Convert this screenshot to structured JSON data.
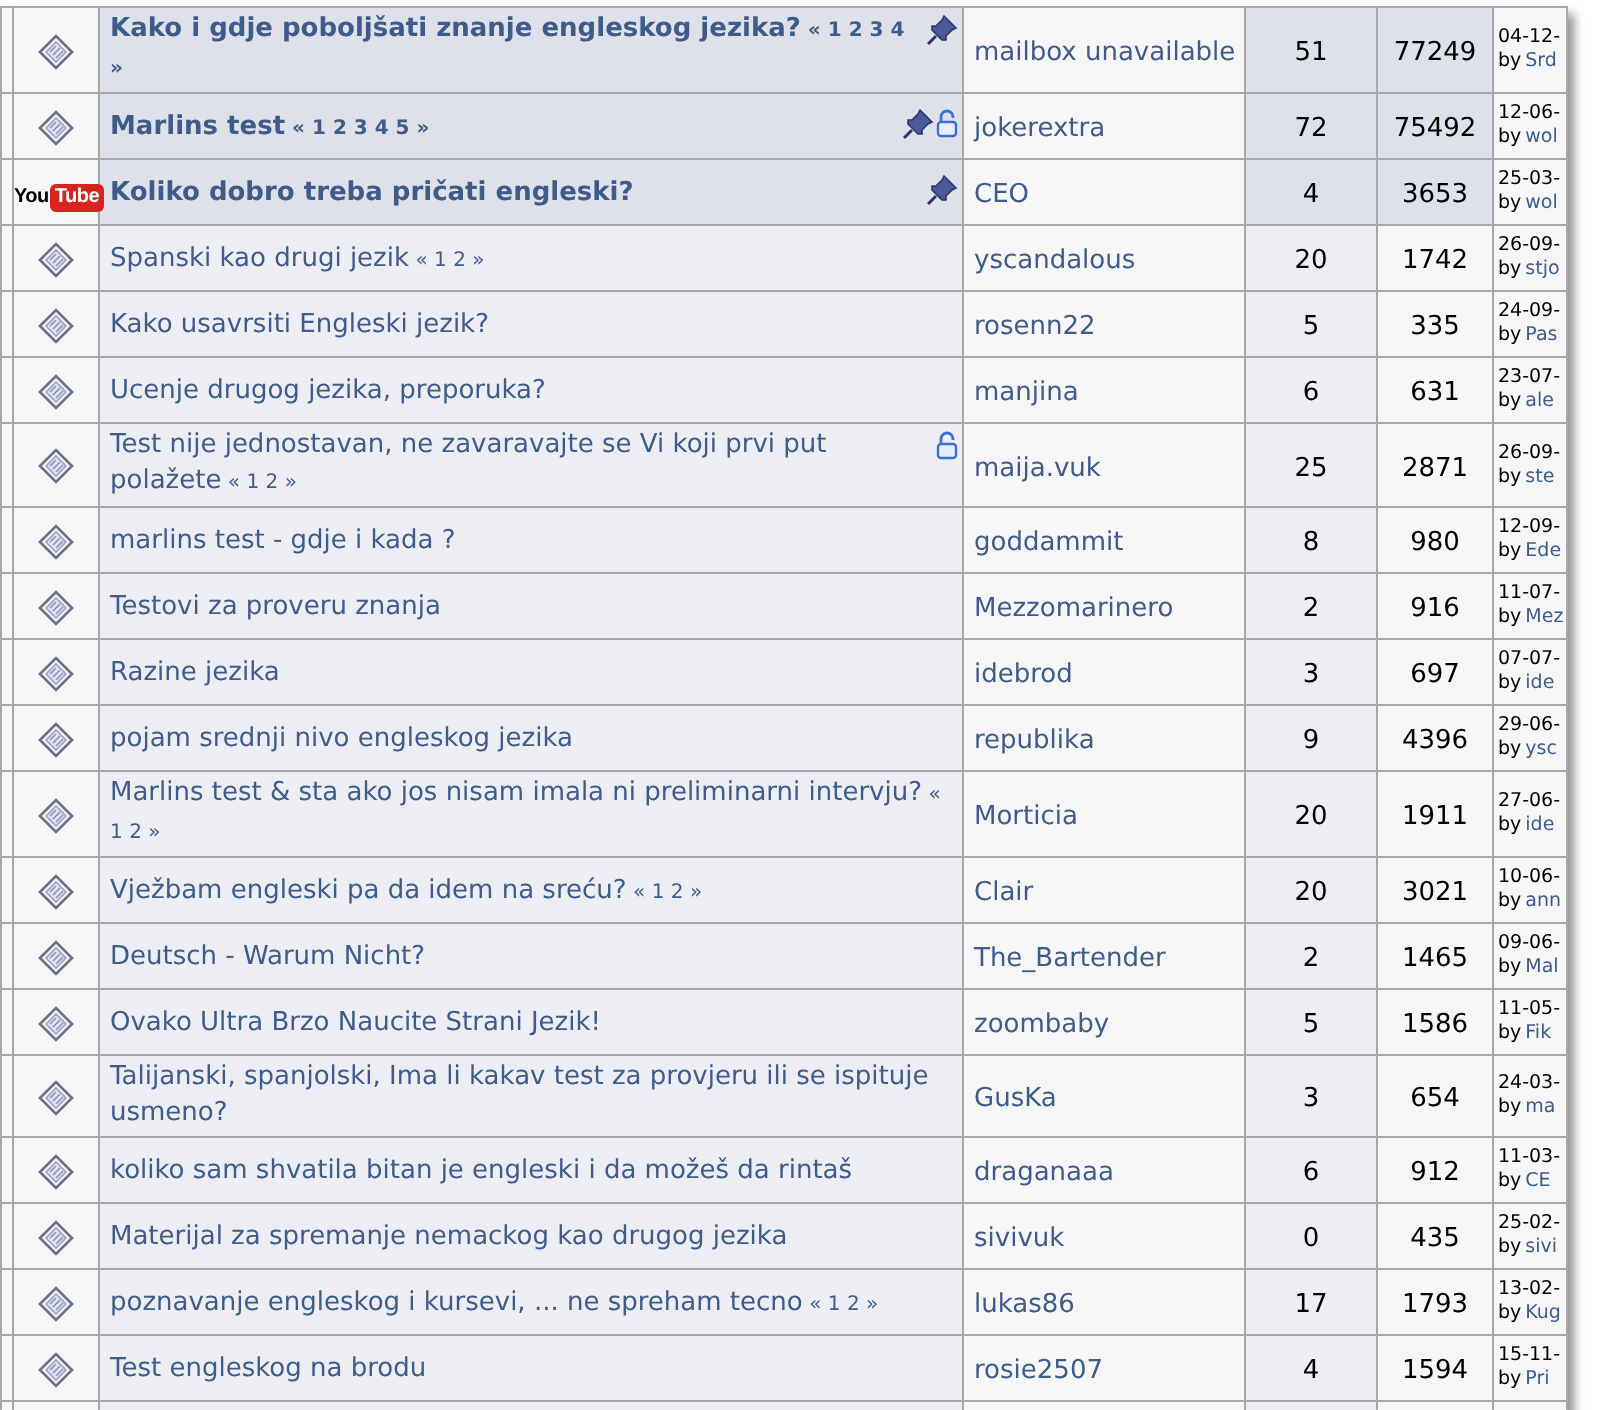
{
  "topics": [
    {
      "kind": "topic",
      "title": "Kako i gdje poboljšati znanje engleskog jezika?",
      "sticky": true,
      "pinned": true,
      "locked": false,
      "pages": {
        "open": "«",
        "numbers": [
          "1",
          "2",
          "3",
          "4"
        ],
        "close": "»"
      },
      "author": "mailbox unavailable",
      "replies": "51",
      "views": "77249",
      "last_date": "04-12-",
      "last_by": "by",
      "last_user": "Srd"
    },
    {
      "kind": "topic",
      "title": "Marlins test",
      "sticky": true,
      "pinned": true,
      "locked": true,
      "pages": {
        "open": "«",
        "numbers": [
          "1",
          "2",
          "3",
          "4",
          "5"
        ],
        "close": "»"
      },
      "author": "jokerextra",
      "replies": "72",
      "views": "75492",
      "last_date": "12-06-",
      "last_by": "by",
      "last_user": "wol"
    },
    {
      "kind": "youtube",
      "logo": {
        "left": "You",
        "right": "Tube"
      },
      "title": "Koliko dobro treba pričati engleski?",
      "sticky": true,
      "pinned": true,
      "locked": false,
      "author": "CEO",
      "replies": "4",
      "views": "3653",
      "last_date": "25-03-",
      "last_by": "by",
      "last_user": "wol"
    },
    {
      "kind": "topic",
      "title": "Spanski kao drugi jezik",
      "sticky": false,
      "pinned": false,
      "locked": false,
      "pages": {
        "open": "«",
        "numbers": [
          "1",
          "2"
        ],
        "close": "»"
      },
      "author": "yscandalous",
      "replies": "20",
      "views": "1742",
      "last_date": "26-09-",
      "last_by": "by",
      "last_user": "stjo"
    },
    {
      "kind": "topic",
      "title": "Kako usavrsiti Engleski jezik?",
      "sticky": false,
      "pinned": false,
      "locked": false,
      "author": "rosenn22",
      "replies": "5",
      "views": "335",
      "last_date": "24-09-",
      "last_by": "by",
      "last_user": "Pas"
    },
    {
      "kind": "topic",
      "title": "Ucenje drugog jezika, preporuka?",
      "sticky": false,
      "pinned": false,
      "locked": false,
      "author": "manjina",
      "replies": "6",
      "views": "631",
      "last_date": "23-07-",
      "last_by": "by",
      "last_user": "ale"
    },
    {
      "kind": "topic",
      "title": "Test nije jednostavan, ne zavaravajte se Vi koji prvi put polažete",
      "sticky": false,
      "pinned": false,
      "locked": true,
      "pages": {
        "open": "«",
        "numbers": [
          "1",
          "2"
        ],
        "close": "»"
      },
      "author": "maija.vuk",
      "replies": "25",
      "views": "2871",
      "last_date": "26-09-",
      "last_by": "by",
      "last_user": "ste"
    },
    {
      "kind": "topic",
      "title": "marlins test - gdje i kada ?",
      "sticky": false,
      "pinned": false,
      "locked": false,
      "author": "goddammit",
      "replies": "8",
      "views": "980",
      "last_date": "12-09-",
      "last_by": "by",
      "last_user": "Ede"
    },
    {
      "kind": "topic",
      "title": "Testovi za proveru znanja",
      "sticky": false,
      "pinned": false,
      "locked": false,
      "author": "Mezzomarinero",
      "replies": "2",
      "views": "916",
      "last_date": "11-07-",
      "last_by": "by",
      "last_user": "Mez"
    },
    {
      "kind": "topic",
      "title": "Razine jezika",
      "sticky": false,
      "pinned": false,
      "locked": false,
      "author": "idebrod",
      "replies": "3",
      "views": "697",
      "last_date": "07-07-",
      "last_by": "by",
      "last_user": "ide"
    },
    {
      "kind": "topic",
      "title": "pojam srednji nivo engleskog jezika",
      "sticky": false,
      "pinned": false,
      "locked": false,
      "author": "republika",
      "replies": "9",
      "views": "4396",
      "last_date": "29-06-",
      "last_by": "by",
      "last_user": "ysc"
    },
    {
      "kind": "topic",
      "title": "Marlins test & sta ako jos nisam imala ni preliminarni intervju?",
      "sticky": false,
      "pinned": false,
      "locked": false,
      "pages": {
        "open": "«",
        "numbers": [
          "1",
          "2"
        ],
        "close": "»"
      },
      "author": "Morticia",
      "replies": "20",
      "views": "1911",
      "last_date": "27-06-",
      "last_by": "by",
      "last_user": "ide"
    },
    {
      "kind": "topic",
      "title": "Vježbam engleski pa da idem na sreću?",
      "sticky": false,
      "pinned": false,
      "locked": false,
      "pages": {
        "open": "«",
        "numbers": [
          "1",
          "2"
        ],
        "close": "»"
      },
      "author": "Clair",
      "replies": "20",
      "views": "3021",
      "last_date": "10-06-",
      "last_by": "by",
      "last_user": "ann"
    },
    {
      "kind": "topic",
      "title": "Deutsch - Warum Nicht?",
      "sticky": false,
      "pinned": false,
      "locked": false,
      "author": "The_Bartender",
      "replies": "2",
      "views": "1465",
      "last_date": "09-06-",
      "last_by": "by",
      "last_user": "Mal"
    },
    {
      "kind": "topic",
      "title": "Ovako Ultra Brzo Naucite Strani Jezik!",
      "sticky": false,
      "pinned": false,
      "locked": false,
      "author": "zoombaby",
      "replies": "5",
      "views": "1586",
      "last_date": "11-05-",
      "last_by": "by",
      "last_user": "Fik"
    },
    {
      "kind": "topic",
      "title": "Talijanski, spanjolski, Ima li kakav test za provjeru ili se ispituje usmeno?",
      "sticky": false,
      "pinned": false,
      "locked": false,
      "author": "GusKa",
      "replies": "3",
      "views": "654",
      "last_date": "24-03-",
      "last_by": "by",
      "last_user": "ma"
    },
    {
      "kind": "topic",
      "title": "koliko sam shvatila bitan je engleski i da možeš da rintaš",
      "sticky": false,
      "pinned": false,
      "locked": false,
      "author": "draganaaa",
      "replies": "6",
      "views": "912",
      "last_date": "11-03-",
      "last_by": "by",
      "last_user": "CE"
    },
    {
      "kind": "topic",
      "title": "Materijal za spremanje nemackog kao drugog jezika",
      "sticky": false,
      "pinned": false,
      "locked": false,
      "author": "sivivuk",
      "replies": "0",
      "views": "435",
      "last_date": "25-02-",
      "last_by": "by",
      "last_user": "sivi"
    },
    {
      "kind": "topic",
      "title": "poznavanje engleskog i kursevi, ... ne spreham tecno",
      "sticky": false,
      "pinned": false,
      "locked": false,
      "pages": {
        "open": "«",
        "numbers": [
          "1",
          "2"
        ],
        "close": "»"
      },
      "author": "lukas86",
      "replies": "17",
      "views": "1793",
      "last_date": "13-02-",
      "last_by": "by",
      "last_user": "Kug"
    },
    {
      "kind": "topic",
      "title": "Test engleskog na brodu",
      "sticky": false,
      "pinned": false,
      "locked": false,
      "author": "rosie2507",
      "replies": "4",
      "views": "1594",
      "last_date": "15-11-",
      "last_by": "by",
      "last_user": "Pri"
    }
  ]
}
